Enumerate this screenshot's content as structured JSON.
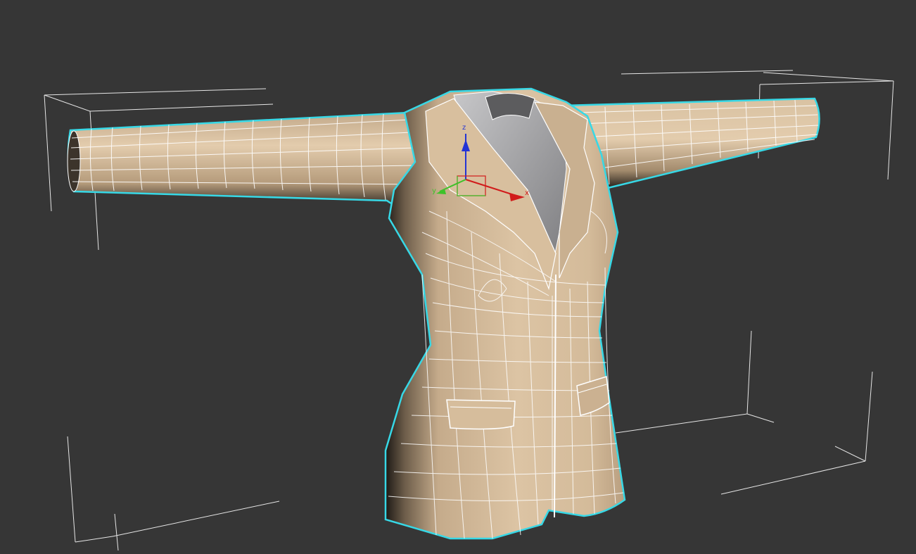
{
  "viewport": {
    "background": "#363636"
  },
  "model": {
    "object": "jacket-mesh",
    "selection_outline_color": "#37d8e6",
    "surface_color": "#cdb494",
    "wire_color": "#ffffff",
    "inner_collar_color": "#9a9a9c"
  },
  "gizmo": {
    "axes": [
      {
        "name": "x",
        "color": "#d11b1b",
        "label": "x"
      },
      {
        "name": "y",
        "color": "#3ec22a",
        "label": "y"
      },
      {
        "name": "z",
        "color": "#2233d6",
        "label": "z"
      }
    ]
  },
  "bounding_box": {
    "color": "#e6e6e6"
  }
}
